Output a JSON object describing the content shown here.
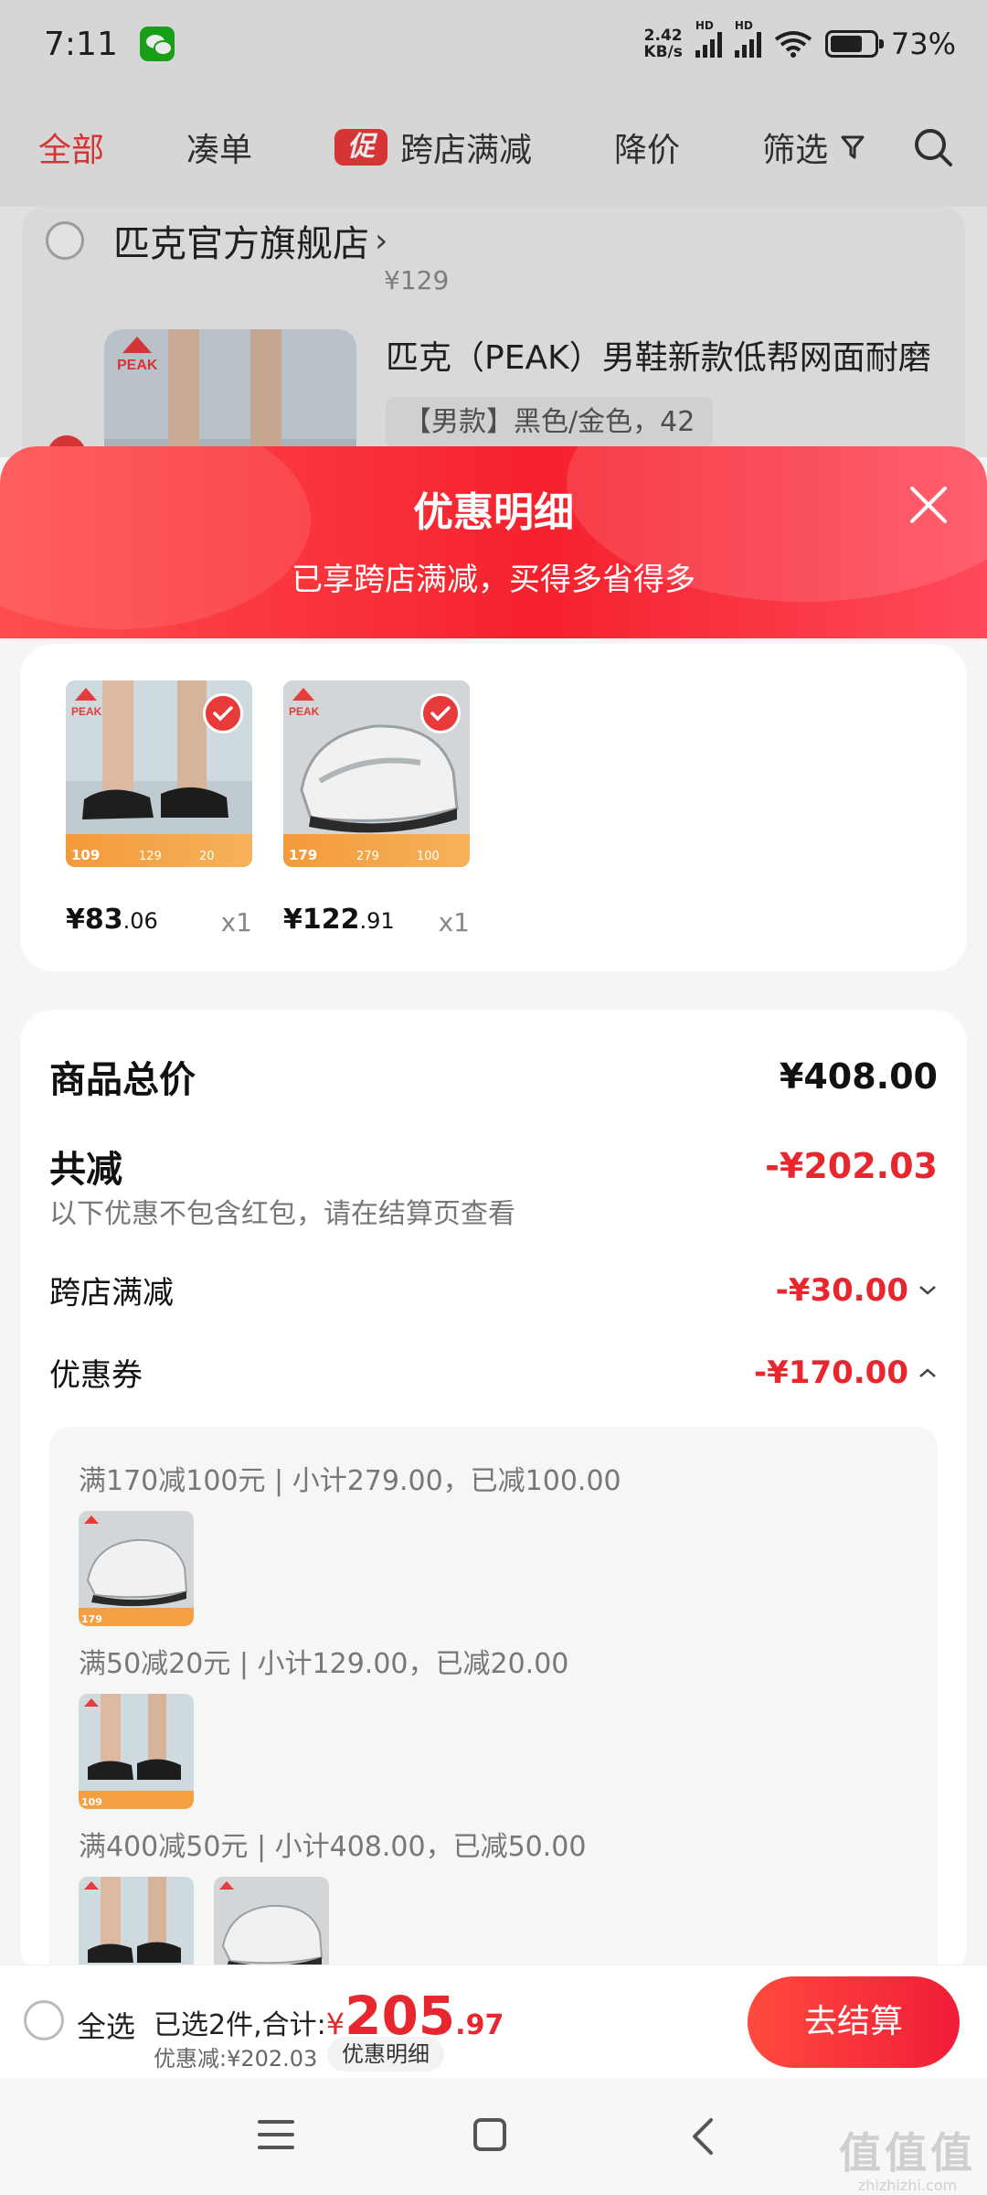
{
  "status_bar": {
    "time": "7:11",
    "net_speed_top": "2.42",
    "net_speed_bottom": "KB/s",
    "battery": "73%"
  },
  "filter_tabs": {
    "all": "全部",
    "bundle": "凑单",
    "promo_badge": "促",
    "promo": "跨店满减",
    "price_drop": "降价",
    "filter": "筛选"
  },
  "background_cart": {
    "store_name": "匹克官方旗舰店",
    "partial_price": "¥129",
    "product_title": "匹克（PEAK）男鞋新款低帮网面耐磨",
    "sku": "【男款】黑色/金色，42"
  },
  "sheet": {
    "title": "优惠明细",
    "subtitle": "已享跨店满减，买得多省得多"
  },
  "selected_items": [
    {
      "price_int": "¥83",
      "price_cents": ".06",
      "qty": "x1",
      "band_price": "109",
      "band_mid": "129",
      "band_right": "20",
      "color": "black"
    },
    {
      "price_int": "¥122",
      "price_cents": ".91",
      "qty": "x1",
      "band_price": "179",
      "band_mid": "279",
      "band_right": "100",
      "color": "white"
    }
  ],
  "summary": {
    "total_label": "商品总价",
    "total_value": "¥408.00",
    "discount_label": "共减",
    "discount_value": "-¥202.03",
    "note": "以下优惠不包含红包，请在结算页查看",
    "cross_store_label": "跨店满减",
    "cross_store_value": "-¥30.00",
    "coupon_label": "优惠券",
    "coupon_value": "-¥170.00"
  },
  "coupons": [
    {
      "text": "满170减100元 | 小计279.00，已减100.00",
      "thumb_price": "179"
    },
    {
      "text": "满50减20元 | 小计129.00，已减20.00",
      "thumb_price": "109"
    },
    {
      "text": "满400减50元 | 小计408.00，已减50.00",
      "thumb_price": ""
    }
  ],
  "bottom_bar": {
    "select_all": "全选",
    "selected_text": "已选2件,合计:",
    "currency": "¥",
    "total_int": "205",
    "total_cents": ".97",
    "discount_text": "优惠减:¥202.03",
    "detail_button": "优惠明细",
    "checkout": "去结算"
  },
  "watermark": {
    "main": "值值值",
    "sub": "zhizhizhi.com"
  },
  "colors": {
    "accent": "#e8262e",
    "header_gradient_start": "#ff4d4d",
    "header_gradient_end": "#f5212d"
  }
}
